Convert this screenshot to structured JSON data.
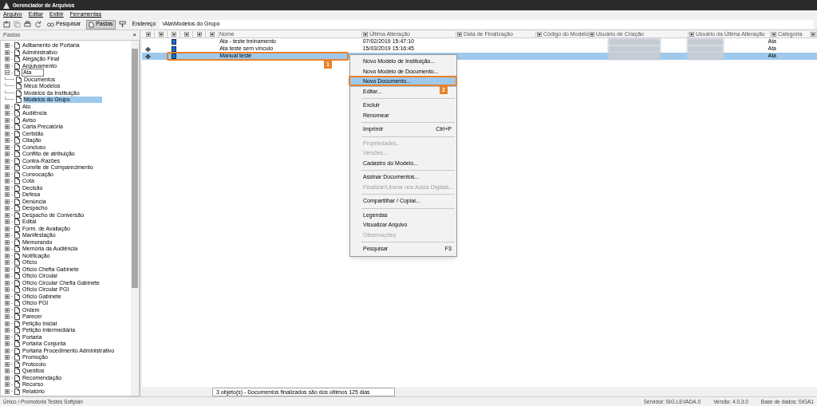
{
  "window": {
    "title": "Gerenciador de Arquivos"
  },
  "menu": [
    "Arquivo",
    "Editar",
    "Exibir",
    "Ferramentas"
  ],
  "toolbar": {
    "buttons": [
      {
        "label": "Pesquisar",
        "selected": false
      },
      {
        "label": "Pastas",
        "selected": true
      }
    ],
    "address_label": "Endereço",
    "address": "\\Ata\\Modelos do Grupo"
  },
  "folders_panel": {
    "title": "Pastas",
    "close": "×"
  },
  "tree": [
    {
      "label": "Aditamento de Portaria",
      "expanded": false,
      "selected": false
    },
    {
      "label": "Administrativo",
      "expanded": false,
      "selected": false
    },
    {
      "label": "Alegação Final",
      "expanded": false,
      "selected": false
    },
    {
      "label": "Arquivamento",
      "expanded": false,
      "selected": false
    },
    {
      "label": "Ata",
      "expanded": true,
      "selected": false,
      "children": [
        {
          "label": "Documentos",
          "selected": false
        },
        {
          "label": "Meus Modelos",
          "selected": false
        },
        {
          "label": "Modelos da Instituição",
          "selected": false
        },
        {
          "label": "Modelos do Grupo",
          "selected": true
        }
      ]
    },
    {
      "label": "Ato",
      "expanded": false,
      "selected": false
    },
    {
      "label": "Audiência",
      "expanded": false,
      "selected": false
    },
    {
      "label": "Aviso",
      "expanded": false,
      "selected": false
    },
    {
      "label": "Carta Precatória",
      "expanded": false,
      "selected": false
    },
    {
      "label": "Certidão",
      "expanded": false,
      "selected": false
    },
    {
      "label": "Citação",
      "expanded": false,
      "selected": false
    },
    {
      "label": "Concluso",
      "expanded": false,
      "selected": false
    },
    {
      "label": "Conflito de atribuição",
      "expanded": false,
      "selected": false
    },
    {
      "label": "Contra-Razões",
      "expanded": false,
      "selected": false
    },
    {
      "label": "Convite de Comparecimento",
      "expanded": false,
      "selected": false
    },
    {
      "label": "Convocação",
      "expanded": false,
      "selected": false
    },
    {
      "label": "Cota",
      "expanded": false,
      "selected": false
    },
    {
      "label": "Decisão",
      "expanded": false,
      "selected": false
    },
    {
      "label": "Defesa",
      "expanded": false,
      "selected": false
    },
    {
      "label": "Denúncia",
      "expanded": false,
      "selected": false
    },
    {
      "label": "Despacho",
      "expanded": false,
      "selected": false
    },
    {
      "label": "Despacho de Conversão",
      "expanded": false,
      "selected": false
    },
    {
      "label": "Edital",
      "expanded": false,
      "selected": false
    },
    {
      "label": "Form. de Avaliação",
      "expanded": false,
      "selected": false
    },
    {
      "label": "Manifestação",
      "expanded": false,
      "selected": false
    },
    {
      "label": "Memorando",
      "expanded": false,
      "selected": false
    },
    {
      "label": "Memória da Audiência",
      "expanded": false,
      "selected": false
    },
    {
      "label": "Notificação",
      "expanded": false,
      "selected": false
    },
    {
      "label": "Ofício",
      "expanded": false,
      "selected": false
    },
    {
      "label": "Ofício Chefia Gabinete",
      "expanded": false,
      "selected": false
    },
    {
      "label": "Ofício Circular",
      "expanded": false,
      "selected": false
    },
    {
      "label": "Ofício Circular Chefia Gabinete",
      "expanded": false,
      "selected": false
    },
    {
      "label": "Ofício Circular PGI",
      "expanded": false,
      "selected": false
    },
    {
      "label": "Ofício Gabinete",
      "expanded": false,
      "selected": false
    },
    {
      "label": "Ofício PGI",
      "expanded": false,
      "selected": false
    },
    {
      "label": "Ordem",
      "expanded": false,
      "selected": false
    },
    {
      "label": "Parecer",
      "expanded": false,
      "selected": false
    },
    {
      "label": "Petição Inicial",
      "expanded": false,
      "selected": false
    },
    {
      "label": "Petição Intermediária",
      "expanded": false,
      "selected": false
    },
    {
      "label": "Portaria",
      "expanded": false,
      "selected": false
    },
    {
      "label": "Portaria Conjunta",
      "expanded": false,
      "selected": false
    },
    {
      "label": "Portaria Procedimento Administrativo",
      "expanded": false,
      "selected": false
    },
    {
      "label": "Promoção",
      "expanded": false,
      "selected": false
    },
    {
      "label": "Protocolo",
      "expanded": false,
      "selected": false
    },
    {
      "label": "Quesitos",
      "expanded": false,
      "selected": false
    },
    {
      "label": "Recomendação",
      "expanded": false,
      "selected": false
    },
    {
      "label": "Recurso",
      "expanded": false,
      "selected": false
    },
    {
      "label": "Relatório",
      "expanded": false,
      "selected": false
    }
  ],
  "table": {
    "columns": [
      "Nome",
      "Última Alteração",
      "Data de Finalização",
      "Código do Modelo",
      "Usuário de Criação",
      "Usuário da Última Alteração",
      "Categoria"
    ],
    "rows": [
      {
        "name": "Ata - teste treinamento",
        "modified": "07/02/2019 15:47:10",
        "category": "Ata",
        "linked": false,
        "selected": false
      },
      {
        "name": "Ata teste sem vínculo",
        "modified": "15/03/2019 15:16:45",
        "category": "Ata",
        "linked": true,
        "selected": false
      },
      {
        "name": "Manual teste",
        "modified": "",
        "category": "Ata",
        "linked": true,
        "selected": true
      }
    ],
    "footer": "3 objeto(s) - Documentos finalizados são dos últimos 125 dias"
  },
  "context_menu": [
    {
      "kind": "item",
      "label": "Novo Modelo de Instituição...",
      "disabled": false,
      "selected": false
    },
    {
      "kind": "item",
      "label": "Novo Modelo de Documento...",
      "disabled": false,
      "selected": false
    },
    {
      "kind": "item",
      "label": "Novo Documento...",
      "disabled": false,
      "selected": true
    },
    {
      "kind": "item",
      "label": "Editar...",
      "disabled": false,
      "selected": false
    },
    {
      "kind": "separator"
    },
    {
      "kind": "item",
      "label": "Excluir",
      "disabled": false,
      "selected": false
    },
    {
      "kind": "item",
      "label": "Renomear",
      "disabled": false,
      "selected": false
    },
    {
      "kind": "separator"
    },
    {
      "kind": "item",
      "label": "Imprimir",
      "shortcut": "Ctrl+P",
      "disabled": false,
      "selected": false
    },
    {
      "kind": "separator"
    },
    {
      "kind": "item",
      "label": "Propriedades...",
      "disabled": true,
      "selected": false
    },
    {
      "kind": "item",
      "label": "Versões...",
      "disabled": true,
      "selected": false
    },
    {
      "kind": "item",
      "label": "Cadastro do Modelo...",
      "disabled": false,
      "selected": false
    },
    {
      "kind": "separator"
    },
    {
      "kind": "item",
      "label": "Assinar Documentos...",
      "disabled": false,
      "selected": false
    },
    {
      "kind": "item",
      "label": "Finalizar/Liberar nos Autos Digitais...",
      "disabled": true,
      "selected": false
    },
    {
      "kind": "separator"
    },
    {
      "kind": "item",
      "label": "Compartilhar / Copiar...",
      "disabled": false,
      "selected": false
    },
    {
      "kind": "separator"
    },
    {
      "kind": "item",
      "label": "Legendas",
      "disabled": false,
      "selected": false
    },
    {
      "kind": "item",
      "label": "Visualizar Arquivo",
      "disabled": false,
      "selected": false
    },
    {
      "kind": "item",
      "label": "Observações",
      "disabled": true,
      "selected": false
    },
    {
      "kind": "separator"
    },
    {
      "kind": "item",
      "label": "Pesquisar",
      "shortcut": "F3",
      "disabled": false,
      "selected": false
    }
  ],
  "annotations": [
    "1",
    "2"
  ],
  "status_bar": {
    "left": "Único / Promotoria Testes Softplan",
    "server": "Servidor: SIG.LEVADA.0",
    "version": "Versão: 4.0.3.0",
    "database": "Base de dados: SIGA1"
  }
}
